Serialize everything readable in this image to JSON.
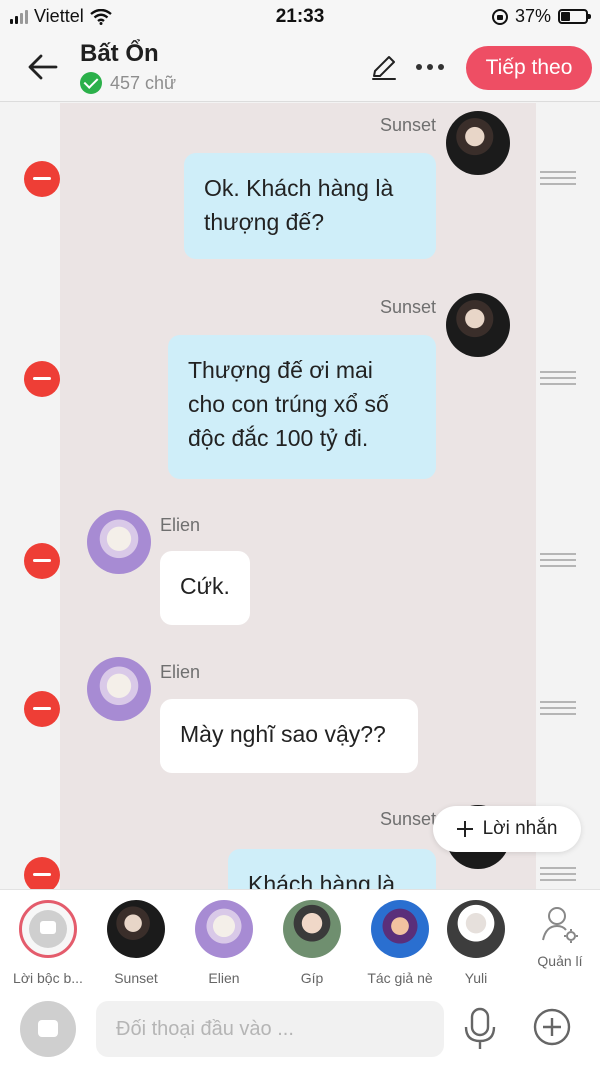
{
  "status_bar": {
    "carrier": "Viettel",
    "time": "21:33",
    "battery": "37%",
    "battery_level": 0.37
  },
  "header": {
    "title": "Bất Ổn",
    "word_count": "457 chữ",
    "next_label": "Tiếp theo"
  },
  "messages": [
    {
      "sender": "Sunset",
      "side": "right",
      "text": "Ok. Khách hàng là\nthượng đế?",
      "style": "blue"
    },
    {
      "sender": "Sunset",
      "side": "right",
      "text": "Thượng đế ơi mai\ncho con trúng xổ số\nđộc đắc 100 tỷ đi.",
      "style": "blue"
    },
    {
      "sender": "Elien",
      "side": "left",
      "text": "Cứk.",
      "style": "white"
    },
    {
      "sender": "Elien",
      "side": "left",
      "text": "Mày nghĩ sao vậy??",
      "style": "white"
    },
    {
      "sender": "Sunset",
      "side": "right",
      "text": "Khách hàng là",
      "style": "blue"
    }
  ],
  "add_message_label": "Lời nhắn",
  "characters": [
    {
      "name": "Lời bộc b..."
    },
    {
      "name": "Sunset"
    },
    {
      "name": "Elien"
    },
    {
      "name": "Gíp"
    },
    {
      "name": "Tác giả nè"
    },
    {
      "name": "Yuli"
    }
  ],
  "manage_label": "Quản lí",
  "input": {
    "placeholder": "Đối thoại đầu vào ..."
  },
  "colors": {
    "accent": "#ee4e64",
    "bubble_blue": "#cfeef9",
    "delete_red": "#ee3e36",
    "panel": "#ebe4e4"
  },
  "icons": [
    "back-arrow-icon",
    "verified-check-icon",
    "pencil-icon",
    "more-dots-icon",
    "remove-icon",
    "drag-handle-icon",
    "plus-icon",
    "narration-icon",
    "manage-user-icon",
    "microphone-icon",
    "add-circle-icon"
  ]
}
